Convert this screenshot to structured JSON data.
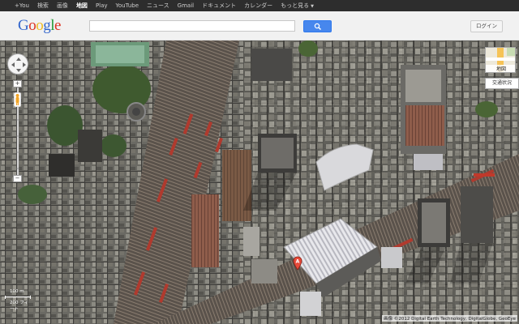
{
  "topbar": {
    "items": [
      "+You",
      "検索",
      "画像",
      "地図",
      "Play",
      "YouTube",
      "ニュース",
      "Gmail",
      "ドキュメント",
      "カレンダー",
      "もっと見る"
    ],
    "active_index": 3
  },
  "header": {
    "logo_letters": [
      "G",
      "o",
      "o",
      "g",
      "l",
      "e"
    ],
    "logo_colors": [
      "#3366cc",
      "#dd3322",
      "#eebb22",
      "#3366cc",
      "#229933",
      "#dd3322"
    ],
    "search_value": "",
    "login_label": "ログイン",
    "search_icon": "search-icon"
  },
  "map": {
    "type_label": "地図",
    "traffic_label": "交通状況",
    "scale_label": "100 m",
    "scale_label_alt": "200 フィート",
    "copyright": "画像 ©2012 Digital Earth Technology, DigitalGlobe, GeoEye",
    "marker_label": "A"
  }
}
